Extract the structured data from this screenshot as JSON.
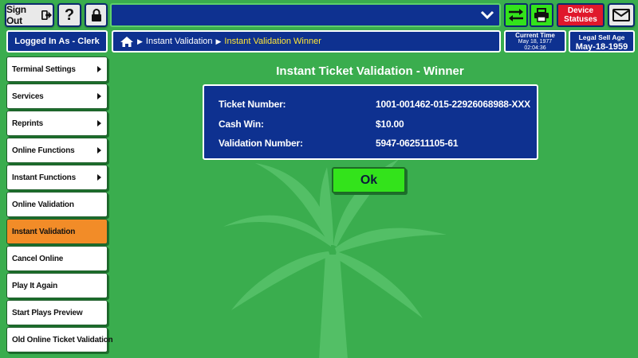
{
  "topbar": {
    "sign_out_label": "Sign Out",
    "help_label": "?",
    "device_statuses_label": "Device Statuses",
    "dropdown_value": ""
  },
  "session": {
    "logged_in_label": "Logged In As - Clerk"
  },
  "breadcrumb": {
    "home_icon": "home-icon",
    "items": [
      "Instant Validation",
      "Instant Validation Winner"
    ]
  },
  "current_time": {
    "label": "Current Time",
    "date": "May 18, 1977",
    "time": "02:04:36"
  },
  "legal_sell_age": {
    "label": "Legal Sell Age",
    "value": "May-18-1959"
  },
  "sidebar": {
    "items": [
      {
        "label": "Terminal Settings",
        "has_submenu": true
      },
      {
        "label": "Services",
        "has_submenu": true
      },
      {
        "label": "Reprints",
        "has_submenu": true
      },
      {
        "label": "Online Functions",
        "has_submenu": true
      },
      {
        "label": "Instant Functions",
        "has_submenu": true
      },
      {
        "label": "Online Validation",
        "has_submenu": false
      },
      {
        "label": "Instant Validation",
        "has_submenu": false,
        "active": true
      },
      {
        "label": "Cancel Online",
        "has_submenu": false
      },
      {
        "label": "Play It Again",
        "has_submenu": false
      },
      {
        "label": "Start Plays Preview",
        "has_submenu": false
      },
      {
        "label": "Old Online Ticket Validation",
        "has_submenu": false
      }
    ]
  },
  "main": {
    "title": "Instant Ticket Validation - Winner",
    "details": [
      {
        "label": "Ticket Number:",
        "value": "1001-001462-015-22926068988-XXX"
      },
      {
        "label": "Cash Win:",
        "value": "$10.00"
      },
      {
        "label": "Validation Number:",
        "value": "5947-062511105-61"
      }
    ],
    "ok_label": "Ok"
  },
  "colors": {
    "background": "#3aad4e",
    "navy": "#0e3190",
    "accent_green": "#33e31b",
    "active_item": "#f28c28",
    "alert_red": "#e0182b",
    "breadcrumb_current": "#ffe536"
  }
}
